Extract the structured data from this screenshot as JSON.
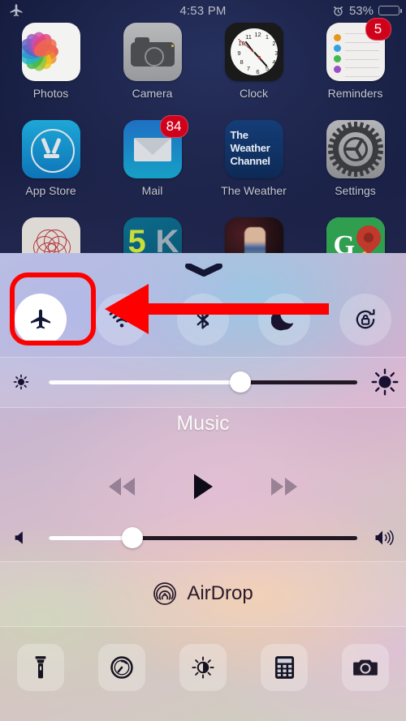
{
  "status_bar": {
    "airplane_icon": "airplane-icon",
    "time": "4:53 PM",
    "alarm_icon": "alarm-clock-icon",
    "battery_percent": "53%",
    "battery_level": 53
  },
  "home_screen": {
    "rows": [
      [
        {
          "label": "Photos",
          "icon": "photos-icon",
          "badge": null
        },
        {
          "label": "Camera",
          "icon": "camera-icon",
          "badge": null
        },
        {
          "label": "Clock",
          "icon": "clock-icon",
          "badge": null
        },
        {
          "label": "Reminders",
          "icon": "reminders-icon",
          "badge": "5"
        }
      ],
      [
        {
          "label": "App Store",
          "icon": "app-store-icon",
          "badge": null
        },
        {
          "label": "Mail",
          "icon": "mail-icon",
          "badge": "84"
        },
        {
          "label": "The Weather",
          "icon": "weather-channel-icon",
          "badge": null
        },
        {
          "label": "Settings",
          "icon": "settings-icon",
          "badge": null
        }
      ]
    ],
    "partial_row": [
      {
        "label": "",
        "icon": "spiral-app-icon",
        "badge": null
      },
      {
        "label": "",
        "icon": "5k-app-icon",
        "badge": null,
        "text": "5K"
      },
      {
        "label": "",
        "icon": "artwork-app-icon",
        "badge": null
      },
      {
        "label": "",
        "icon": "google-maps-icon",
        "badge": null,
        "text": "G"
      }
    ],
    "weather_icon_text": [
      "The",
      "Weather",
      "Channel"
    ],
    "clock_numerals": [
      "12",
      "1",
      "2",
      "3",
      "4",
      "5",
      "6",
      "7",
      "8",
      "9",
      "10",
      "11"
    ]
  },
  "control_center": {
    "grabber_icon": "chevron-down-grabber-icon",
    "toggles": [
      {
        "name": "airplane-mode",
        "icon": "airplane-icon",
        "state": "on"
      },
      {
        "name": "wifi",
        "icon": "wifi-icon",
        "state": "off"
      },
      {
        "name": "bluetooth",
        "icon": "bluetooth-icon",
        "state": "off"
      },
      {
        "name": "do-not-disturb",
        "icon": "moon-icon",
        "state": "off"
      },
      {
        "name": "rotation-lock",
        "icon": "rotation-lock-icon",
        "state": "off"
      }
    ],
    "brightness": {
      "name": "brightness-slider",
      "value": 62,
      "left_icon": "brightness-low-icon",
      "right_icon": "brightness-high-icon"
    },
    "music": {
      "title": "Music",
      "rewind_icon": "rewind-icon",
      "play_icon": "play-icon",
      "fast_forward_icon": "fast-forward-icon",
      "volume": {
        "name": "volume-slider",
        "value": 27,
        "left_icon": "volume-mute-icon",
        "right_icon": "volume-high-icon"
      }
    },
    "airdrop": {
      "label": "AirDrop",
      "icon": "airdrop-icon"
    },
    "shortcuts": [
      {
        "name": "flashlight",
        "icon": "flashlight-icon"
      },
      {
        "name": "timer",
        "icon": "timer-icon"
      },
      {
        "name": "night-shift",
        "icon": "night-shift-icon"
      },
      {
        "name": "calculator",
        "icon": "calculator-icon"
      },
      {
        "name": "camera",
        "icon": "camera-icon"
      }
    ]
  },
  "annotations": {
    "highlight_color": "#fe0000",
    "highlight_target": "airplane-mode-toggle",
    "arrow_color": "#fe0000",
    "arrow_direction": "left",
    "arrow_target": "airplane-mode-toggle"
  }
}
